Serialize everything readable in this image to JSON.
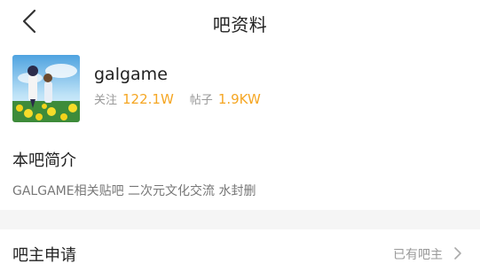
{
  "header": {
    "title": "吧资料",
    "back_icon": "back-arrow-icon"
  },
  "forum": {
    "name": "galgame",
    "follow_label": "关注",
    "follow_count": "122.1W",
    "posts_label": "帖子",
    "posts_count": "1.9KW",
    "accent_color": "#f5a623"
  },
  "intro": {
    "heading": "本吧简介",
    "text": "GALGAME相关贴吧 二次元文化交流 水封删"
  },
  "owner_row": {
    "label": "吧主申请",
    "value": "已有吧主",
    "icon": "chevron-right-icon"
  }
}
